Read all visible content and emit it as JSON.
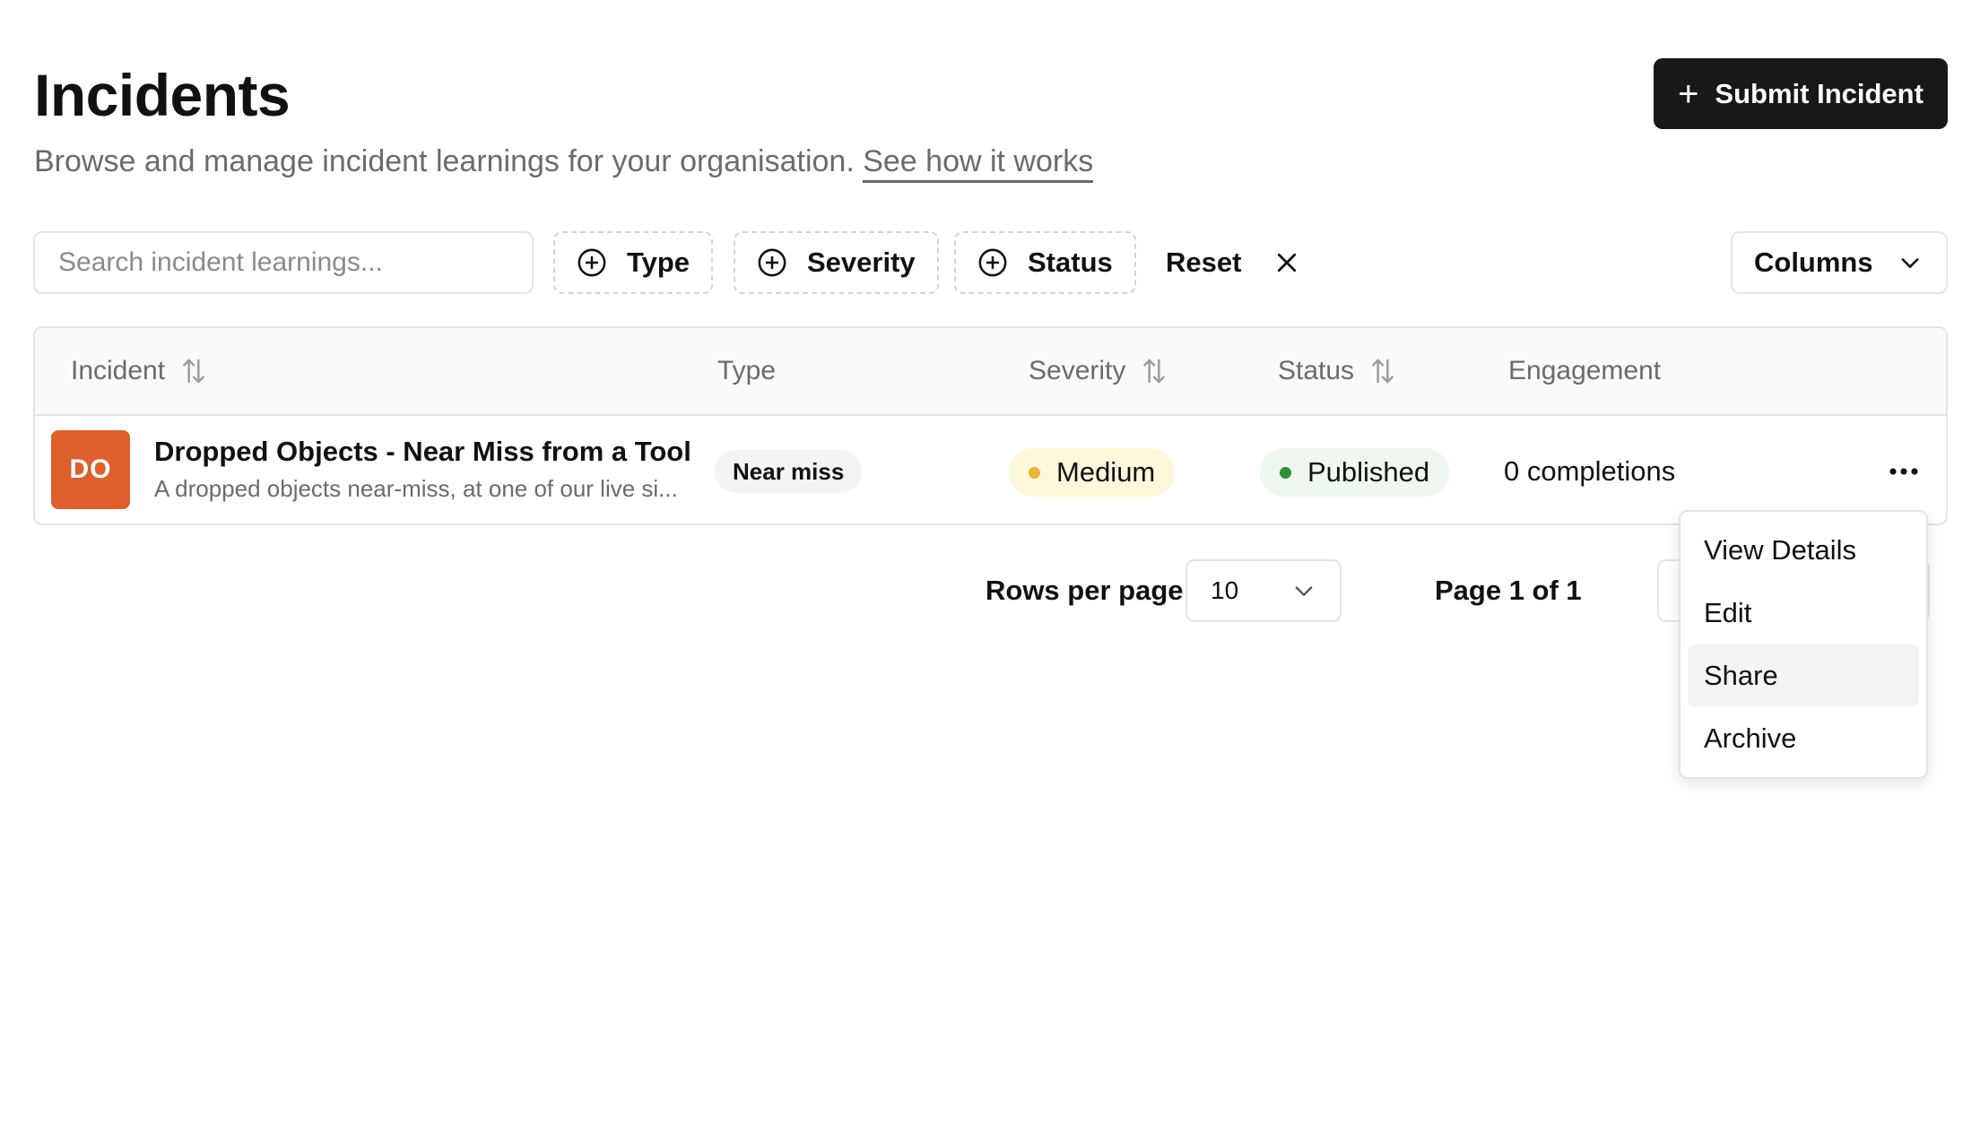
{
  "header": {
    "title": "Incidents",
    "subtitle": "Browse and manage incident learnings for your organisation.",
    "help_link": "See how it works",
    "submit_label": "Submit Incident"
  },
  "toolbar": {
    "search_placeholder": "Search incident learnings...",
    "filters": [
      "Type",
      "Severity",
      "Status"
    ],
    "reset_label": "Reset",
    "columns_label": "Columns"
  },
  "table": {
    "columns": [
      "Incident",
      "Type",
      "Severity",
      "Status",
      "Engagement"
    ],
    "rows": [
      {
        "avatar": "DO",
        "avatar_color": "#dd5f2c",
        "title": "Dropped Objects - Near Miss from a Tool",
        "description": "A dropped objects near-miss, at one of our live si...",
        "type": "Near miss",
        "severity": "Medium",
        "severity_color": "#e7b53a",
        "status": "Published",
        "status_color": "#2f8f3a",
        "engagement": "0 completions"
      }
    ]
  },
  "pagination": {
    "rows_per_page_label": "Rows per page",
    "rows_per_page_value": "10",
    "page_label": "Page 1 of 1"
  },
  "context_menu": {
    "items": [
      "View Details",
      "Edit",
      "Share",
      "Archive"
    ],
    "highlighted": "Share"
  }
}
